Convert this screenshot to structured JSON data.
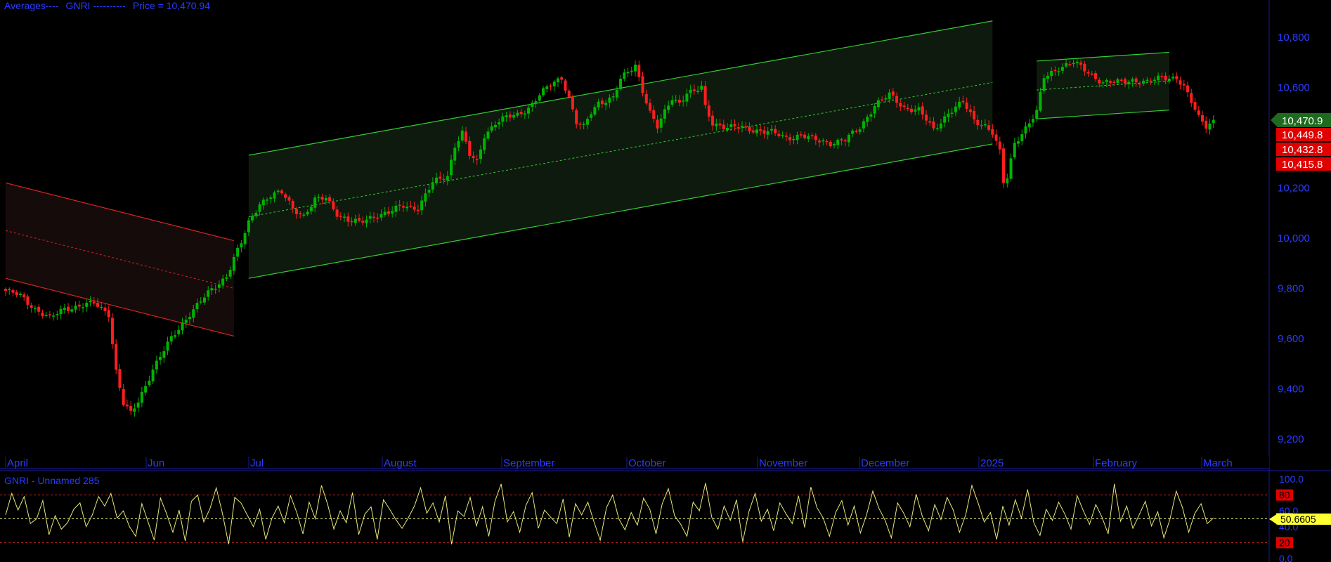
{
  "header": {
    "averages_label": "Averages----",
    "symbol_label": "GNRI ----------",
    "price_label": "Price = 10,470.94"
  },
  "oscillator": {
    "title": "GNRI - Unnamed 285",
    "current_value": "50.6605",
    "ticks": [
      "100.0",
      "80",
      "60.0",
      "50",
      "40.0",
      "20",
      "0.0"
    ]
  },
  "price_badges": [
    {
      "text": "10,470.9",
      "color": "#1e6a1e"
    },
    {
      "text": "10,449.8",
      "color": "#e00000"
    },
    {
      "text": "10,432.8",
      "color": "#e00000"
    },
    {
      "text": "10,415.8",
      "color": "#e00000"
    }
  ],
  "colors": {
    "up": "#00b400",
    "down": "#ff1e1e",
    "channel_up": "#33cc33",
    "channel_down": "#dd2222",
    "axis_text": "#2b3cff",
    "osc_line": "#e8e87a"
  },
  "chart_data": {
    "type": "candlestick",
    "title": "Averages---- GNRI ---------- Price = 10,470.94",
    "y_ticks": [
      "10,800",
      "10,600",
      "10,400",
      "10,200",
      "10,000",
      "9,800",
      "9,600",
      "9,400",
      "9,200"
    ],
    "ylim": [
      9120,
      10950
    ],
    "x_labels": [
      "April",
      "Jun",
      "Jul",
      "August",
      "September",
      "October",
      "November",
      "December",
      "2025",
      "February",
      "March"
    ],
    "last_price": 10470.94,
    "anchors": [
      [
        0,
        9790
      ],
      [
        4,
        9770
      ],
      [
        8,
        9720
      ],
      [
        12,
        9680
      ],
      [
        16,
        9720
      ],
      [
        20,
        9730
      ],
      [
        24,
        9740
      ],
      [
        28,
        9700
      ],
      [
        30,
        9470
      ],
      [
        32,
        9340
      ],
      [
        34,
        9300
      ],
      [
        36,
        9350
      ],
      [
        40,
        9480
      ],
      [
        45,
        9600
      ],
      [
        50,
        9700
      ],
      [
        55,
        9780
      ],
      [
        60,
        9850
      ],
      [
        62,
        9920
      ],
      [
        64,
        9980
      ],
      [
        66,
        10060
      ],
      [
        69,
        10140
      ],
      [
        72,
        10170
      ],
      [
        75,
        10180
      ],
      [
        78,
        10120
      ],
      [
        81,
        10090
      ],
      [
        84,
        10150
      ],
      [
        87,
        10160
      ],
      [
        90,
        10100
      ],
      [
        93,
        10070
      ],
      [
        96,
        10060
      ],
      [
        100,
        10090
      ],
      [
        104,
        10100
      ],
      [
        108,
        10130
      ],
      [
        112,
        10120
      ],
      [
        116,
        10220
      ],
      [
        120,
        10250
      ],
      [
        122,
        10370
      ],
      [
        124,
        10420
      ],
      [
        126,
        10330
      ],
      [
        128,
        10300
      ],
      [
        130,
        10410
      ],
      [
        133,
        10460
      ],
      [
        136,
        10480
      ],
      [
        139,
        10490
      ],
      [
        142,
        10520
      ],
      [
        145,
        10570
      ],
      [
        148,
        10610
      ],
      [
        151,
        10640
      ],
      [
        153,
        10560
      ],
      [
        155,
        10460
      ],
      [
        157,
        10440
      ],
      [
        159,
        10500
      ],
      [
        161,
        10540
      ],
      [
        163,
        10550
      ],
      [
        165,
        10560
      ],
      [
        167,
        10630
      ],
      [
        169,
        10660
      ],
      [
        171,
        10690
      ],
      [
        173,
        10590
      ],
      [
        175,
        10500
      ],
      [
        177,
        10440
      ],
      [
        179,
        10500
      ],
      [
        181,
        10560
      ],
      [
        183,
        10540
      ],
      [
        185,
        10580
      ],
      [
        187,
        10580
      ],
      [
        189,
        10600
      ],
      [
        190,
        10520
      ],
      [
        192,
        10460
      ],
      [
        196,
        10440
      ],
      [
        200,
        10440
      ],
      [
        204,
        10430
      ],
      [
        208,
        10420
      ],
      [
        212,
        10400
      ],
      [
        216,
        10410
      ],
      [
        220,
        10390
      ],
      [
        224,
        10380
      ],
      [
        228,
        10390
      ],
      [
        232,
        10440
      ],
      [
        236,
        10530
      ],
      [
        240,
        10570
      ],
      [
        244,
        10520
      ],
      [
        248,
        10510
      ],
      [
        252,
        10430
      ],
      [
        256,
        10500
      ],
      [
        260,
        10540
      ],
      [
        263,
        10470
      ],
      [
        266,
        10450
      ],
      [
        268,
        10420
      ],
      [
        270,
        10340
      ],
      [
        271,
        10220
      ],
      [
        272,
        10240
      ],
      [
        274,
        10380
      ],
      [
        276,
        10420
      ],
      [
        278,
        10460
      ],
      [
        280,
        10500
      ],
      [
        282,
        10640
      ],
      [
        284,
        10660
      ],
      [
        286,
        10680
      ],
      [
        290,
        10700
      ],
      [
        294,
        10660
      ],
      [
        298,
        10620
      ],
      [
        302,
        10620
      ],
      [
        306,
        10630
      ],
      [
        310,
        10620
      ],
      [
        314,
        10640
      ],
      [
        318,
        10640
      ],
      [
        320,
        10600
      ],
      [
        322,
        10540
      ],
      [
        324,
        10480
      ],
      [
        326,
        10450
      ],
      [
        328,
        10471
      ]
    ],
    "channels": [
      {
        "name": "down",
        "start": {
          "x": 0,
          "y": 10030
        },
        "end": {
          "x": 62,
          "y": 9800
        },
        "half_width": 190
      },
      {
        "name": "up-1",
        "start": {
          "x": 66,
          "y": 10085
        },
        "end": {
          "x": 268,
          "y": 10620
        },
        "half_width": 245
      },
      {
        "name": "up-2",
        "start": {
          "x": 280,
          "y": 10590
        },
        "end": {
          "x": 316,
          "y": 10625
        },
        "half_width": 115
      }
    ],
    "oscillator": {
      "ylim": [
        0,
        100
      ],
      "levels": [
        80,
        50,
        20
      ],
      "values": [
        55,
        82,
        61,
        78,
        44,
        50,
        73,
        30,
        54,
        37,
        45,
        62,
        70,
        40,
        55,
        78,
        66,
        82,
        51,
        60,
        40,
        28,
        69,
        46,
        23,
        76,
        56,
        33,
        61,
        22,
        72,
        80,
        46,
        63,
        89,
        57,
        18,
        77,
        70,
        55,
        40,
        62,
        24,
        51,
        66,
        45,
        79,
        58,
        31,
        71,
        50,
        92,
        68,
        37,
        60,
        45,
        83,
        30,
        56,
        65,
        24,
        74,
        62,
        49,
        38,
        51,
        66,
        89,
        57,
        70,
        46,
        79,
        18,
        60,
        53,
        77,
        41,
        65,
        28,
        72,
        94,
        46,
        59,
        33,
        67,
        83,
        38,
        61,
        52,
        44,
        75,
        27,
        69,
        55,
        71,
        46,
        23,
        64,
        80,
        50,
        36,
        58,
        42,
        76,
        62,
        31,
        69,
        88,
        54,
        43,
        28,
        71,
        60,
        95,
        52,
        37,
        66,
        48,
        74,
        21,
        59,
        82,
        47,
        62,
        35,
        70,
        56,
        44,
        79,
        39,
        90,
        64,
        51,
        28,
        58,
        73,
        42,
        66,
        32,
        55,
        85,
        63,
        48,
        26,
        70,
        57,
        40,
        81,
        53,
        35,
        68,
        49,
        77,
        61,
        33,
        55,
        92,
        70,
        46,
        58,
        24,
        66,
        42,
        74,
        51,
        87,
        45,
        29,
        62,
        48,
        71,
        56,
        37,
        79,
        60,
        43,
        68,
        52,
        31,
        94,
        47,
        66,
        38,
        55,
        72,
        41,
        59,
        26,
        50,
        85,
        64,
        33,
        57,
        69,
        44,
        51
      ]
    }
  }
}
